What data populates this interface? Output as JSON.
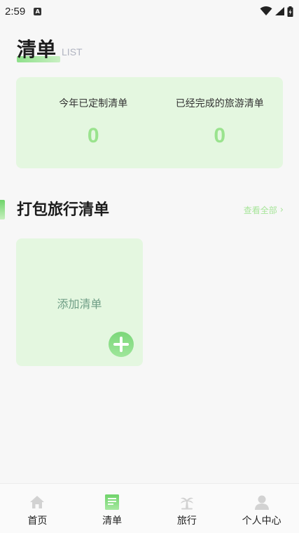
{
  "status_bar": {
    "time": "2:59",
    "notification_letter": "A"
  },
  "header": {
    "title": "清单",
    "subtitle": "LIST"
  },
  "stats": [
    {
      "label": "今年已定制清单",
      "value": "0"
    },
    {
      "label": "已经完成的旅游清单",
      "value": "0"
    }
  ],
  "section": {
    "title": "打包旅行清单",
    "view_all": "查看全部",
    "view_all_chevron": "›"
  },
  "add_card": {
    "label": "添加清单"
  },
  "nav": {
    "items": [
      {
        "label": "首页",
        "icon": "home-icon"
      },
      {
        "label": "清单",
        "icon": "list-icon"
      },
      {
        "label": "旅行",
        "icon": "palm-tree-icon"
      },
      {
        "label": "个人中心",
        "icon": "person-icon"
      }
    ],
    "active_index": 1
  },
  "colors": {
    "accent": "#7cd77a",
    "card_background": "#e4f7e0",
    "stat_value": "#9ae38e",
    "inactive_icon": "#d2d2d2"
  }
}
